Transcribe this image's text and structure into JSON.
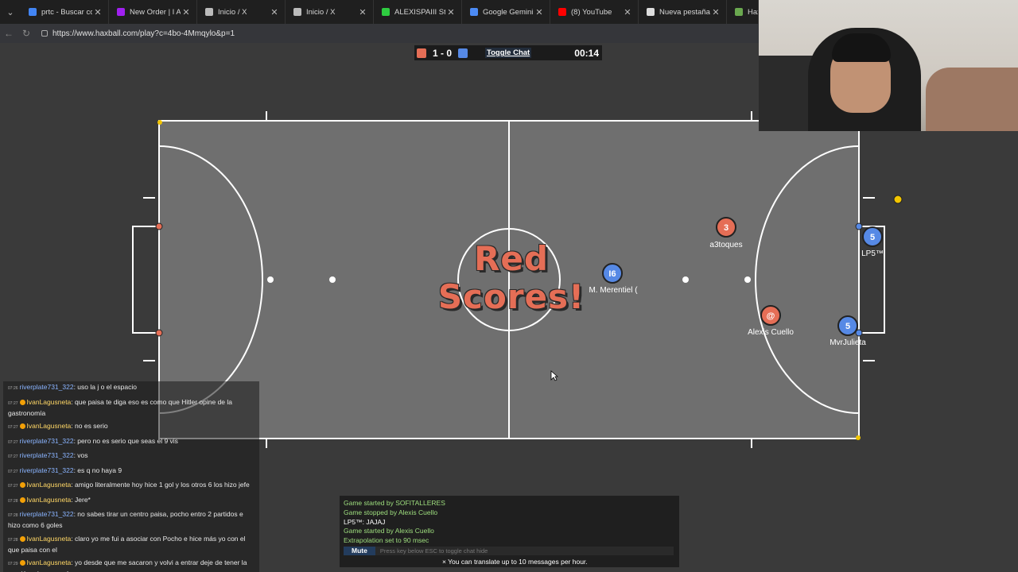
{
  "browser": {
    "tabs": [
      {
        "label": "prtc - Buscar con Go",
        "color": "#4285f4"
      },
      {
        "label": "New Order | I Am Pr",
        "color": "#a020f0"
      },
      {
        "label": "Inicio / X",
        "color": "#bbbbbb"
      },
      {
        "label": "Inicio / X",
        "color": "#bbbbbb"
      },
      {
        "label": "ALEXISPAIII Stream",
        "color": "#2ecc40"
      },
      {
        "label": "Google Gemini",
        "color": "#4c8bf5"
      },
      {
        "label": "(8) YouTube",
        "color": "#ff0000"
      },
      {
        "label": "Nueva pestaña",
        "color": "#dddddd"
      },
      {
        "label": "Haxba",
        "color": "#6aa84f"
      }
    ],
    "url": "https://www.haxball.com/play?c=4bo-4Mmqylo&p=1"
  },
  "scoreboard": {
    "score": "1 - 0",
    "toggle_chat": "Toggle Chat",
    "time": "00:14"
  },
  "banner": {
    "line1": "Red",
    "line2": "Scores!"
  },
  "players": [
    {
      "number": "3",
      "name": "a3toques",
      "team": "red"
    },
    {
      "number": "@",
      "name": "Alexis Cuello",
      "team": "red"
    },
    {
      "number": "I6",
      "name": "M. Merentiel (",
      "team": "blue"
    },
    {
      "number": "5",
      "name": "LP5™",
      "team": "blue"
    },
    {
      "number": "5",
      "name": "MvrJulieta",
      "team": "blue"
    }
  ],
  "colors": {
    "red": "#e56e56",
    "blue": "#5689e5",
    "pitch": "#6e6e6e",
    "ball": "#f2c500"
  },
  "chat": [
    {
      "ts": "07:26",
      "user": "riverplate731_322",
      "style": "blue",
      "badge": false,
      "text": ": uso la j o el espacio"
    },
    {
      "ts": "07:27",
      "user": "IvanLagusneta",
      "style": "blue",
      "badge": true,
      "text": ": que paisa te diga eso es como que Hitler opine de la gastronomía"
    },
    {
      "ts": "07:27",
      "user": "IvanLagusneta",
      "style": "blue",
      "badge": true,
      "text": ": no es serio"
    },
    {
      "ts": "07:27",
      "user": "riverplate731_322",
      "style": "blue",
      "badge": false,
      "text": ": pero no es serio que seas el 9 vis"
    },
    {
      "ts": "07:27",
      "user": "riverplate731_322",
      "style": "blue",
      "badge": false,
      "text": ": vos"
    },
    {
      "ts": "07:27",
      "user": "riverplate731_322",
      "style": "blue",
      "badge": false,
      "text": ": es q no haya 9"
    },
    {
      "ts": "07:27",
      "user": "IvanLagusneta",
      "style": "blue",
      "badge": true,
      "text": ": amigo literalmente hoy hice 1 gol y los otros 6 los hizo jefe"
    },
    {
      "ts": "07:28",
      "user": "IvanLagusneta",
      "style": "blue",
      "badge": true,
      "text": ": Jere*"
    },
    {
      "ts": "07:28",
      "user": "riverplate731_322",
      "style": "blue",
      "badge": false,
      "text": ": no sabes tirar un centro paisa, pocho entro 2 partidos e hizo como 6 goles"
    },
    {
      "ts": "07:28",
      "user": "IvanLagusneta",
      "style": "blue",
      "badge": true,
      "text": ": claro yo me fui a asociar con Pocho e hice más yo con el que paisa con el"
    },
    {
      "ts": "07:29",
      "user": "IvanLagusneta",
      "style": "blue",
      "badge": true,
      "text": ": yo desde que me sacaron y volvi a entrar deje de tener la presión y jugar con bronca"
    }
  ],
  "game_log": {
    "lines": [
      {
        "text": "Game started by SOFITALLERES",
        "style": "g"
      },
      {
        "text": "Game stopped by Alexis Cuello",
        "style": "g"
      },
      {
        "text": "LP5™: JAJAJ",
        "style": "w"
      },
      {
        "text": "Game started by Alexis Cuello",
        "style": "g"
      },
      {
        "text": "Extrapolation set to 90 msec",
        "style": "g"
      }
    ],
    "mute_label": "Mute",
    "input_placeholder": "Press key below ESC to toggle chat hide",
    "translate_note": "× You can translate up to 10 messages per hour."
  }
}
